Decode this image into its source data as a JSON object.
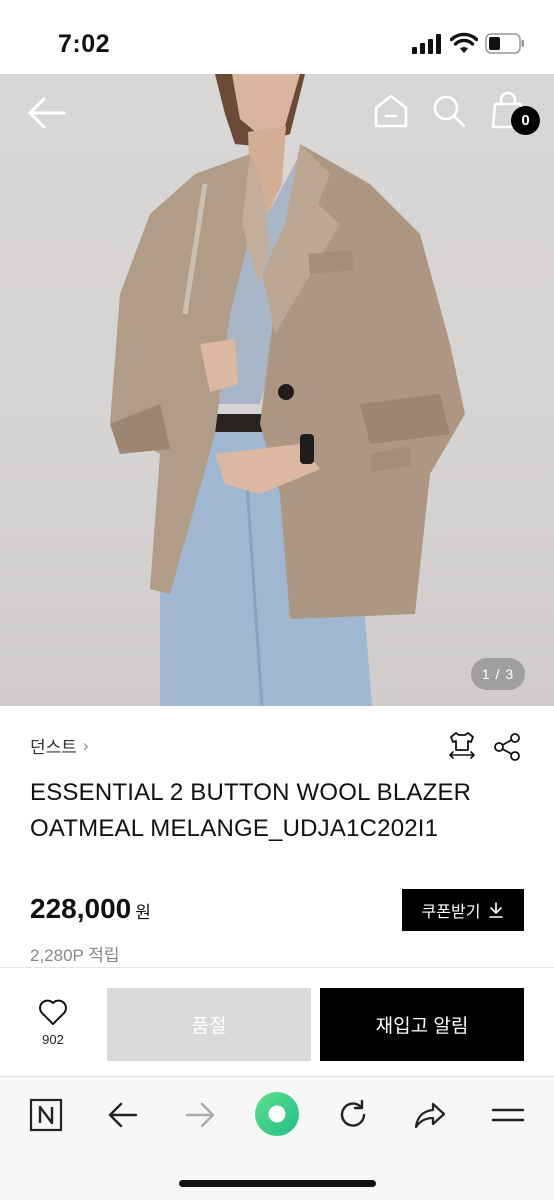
{
  "status_bar": {
    "time": "7:02"
  },
  "header": {
    "cart_count": "0"
  },
  "gallery": {
    "indicator": "1 / 3"
  },
  "product": {
    "brand": "던스트",
    "brand_chevron": "›",
    "title_line1": "ESSENTIAL 2 BUTTON WOOL BLAZER",
    "title_line2": "OATMEAL MELANGE_UDJA1C202I1",
    "price": "228,000",
    "price_unit": "원",
    "points": "2,280P 적립",
    "coupon_label": "쿠폰받기"
  },
  "actions": {
    "wish_count": "902",
    "soldout_label": "품절",
    "restock_label": "재입고 알림"
  },
  "icons": {
    "back": "arrow-left-icon",
    "home": "home-icon",
    "search": "search-icon",
    "cart": "shopping-bag-icon",
    "fit": "size-guide-icon",
    "share": "share-icon",
    "heart": "heart-icon",
    "download": "download-icon"
  },
  "colors": {
    "accent": "#000000",
    "soldout_bg": "#d9d9d9",
    "browser_green": "#3fd07a"
  }
}
